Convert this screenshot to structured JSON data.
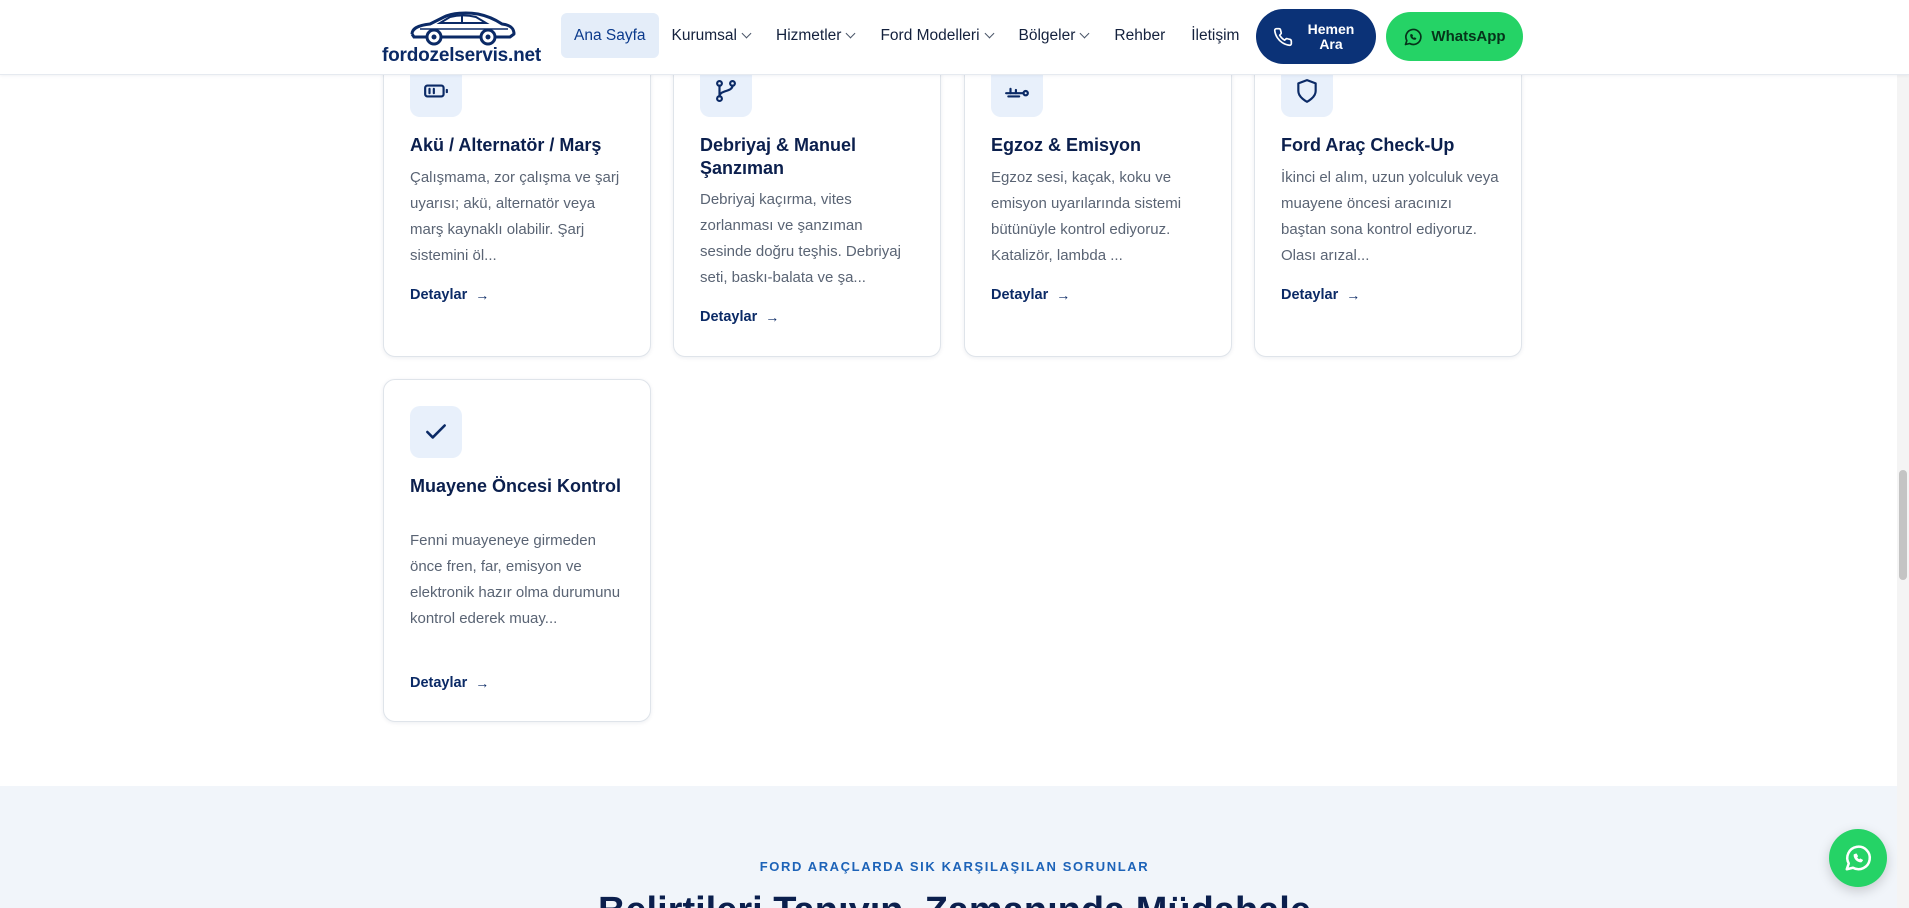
{
  "header": {
    "logo_text": "fordozelservis.net",
    "nav": [
      {
        "label": "Ana Sayfa",
        "active": true,
        "has_dropdown": false
      },
      {
        "label": "Kurumsal",
        "active": false,
        "has_dropdown": true
      },
      {
        "label": "Hizmetler",
        "active": false,
        "has_dropdown": true
      },
      {
        "label": "Ford Modelleri",
        "active": false,
        "has_dropdown": true
      },
      {
        "label": "Bölgeler",
        "active": false,
        "has_dropdown": true
      },
      {
        "label": "Rehber",
        "active": false,
        "has_dropdown": false
      },
      {
        "label": "İletişim",
        "active": false,
        "has_dropdown": false
      }
    ],
    "call_button": {
      "line1": "Hemen",
      "line2": "Ara",
      "icon": "phone-icon"
    },
    "whatsapp_button": {
      "label": "WhatsApp",
      "icon": "whatsapp-icon"
    }
  },
  "cards": [
    {
      "icon": "battery-icon",
      "title": "Akü / Alternatör / Marş",
      "description": "Çalışmama, zor çalışma ve şarj uyarısı; akü, alternatör veya marş kaynaklı olabilir. Şarj sistemini öl...",
      "link": "Detaylar"
    },
    {
      "icon": "git-branch-icon",
      "title": "Debriyaj & Manuel Şanzıman",
      "description": "Debriyaj kaçırma, vites zorlanması ve şanzıman sesinde doğru teşhis. Debriyaj seti, baskı-balata ve şa...",
      "link": "Detaylar"
    },
    {
      "icon": "exhaust-icon",
      "title": "Egzoz & Emisyon",
      "description": "Egzoz sesi, kaçak, koku ve emisyon uyarılarında sistemi bütünüyle kontrol ediyoruz. Katalizör, lambda ...",
      "link": "Detaylar"
    },
    {
      "icon": "shield-icon",
      "title": "Ford Araç Check-Up",
      "description": "İkinci el alım, uzun yolculuk veya muayene öncesi aracınızı baştan sona kontrol ediyoruz. Olası arızal...",
      "link": "Detaylar"
    },
    {
      "icon": "check-icon",
      "title": "Muayene Öncesi Kontrol",
      "description": "Fenni muayeneye girmeden önce fren, far, emisyon ve elektronik hazır olma durumunu kontrol ederek muay...",
      "link": "Detaylar"
    }
  ],
  "faq": {
    "eyebrow": "FORD ARAÇLARDA SIK KARŞILAŞILAN SORUNLAR",
    "title": "Belirtileri Tanıyın, Zamanında Müdahale"
  },
  "colors": {
    "primary": "#0b3277",
    "whatsapp": "#25d366",
    "accent": "#1d63b8"
  }
}
